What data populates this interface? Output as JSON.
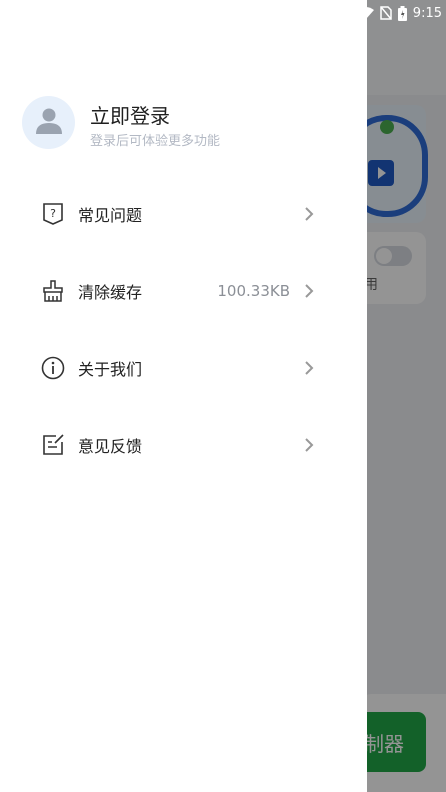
{
  "statusbar": {
    "time": "9:15"
  },
  "profile": {
    "title": "立即登录",
    "subtitle": "登录后可体验更多功能"
  },
  "menu": {
    "faq": {
      "label": "常见问题"
    },
    "clear_cache": {
      "label": "清除缓存",
      "value": "100.33KB"
    },
    "about": {
      "label": "关于我们"
    },
    "feedback": {
      "label": "意见反馈"
    }
  },
  "background": {
    "partial_text": "用",
    "button_text": "制器"
  },
  "colors": {
    "accent": "#22a748",
    "avatar_bg": "#e7f0fb",
    "subtitle": "#b3b9c4"
  }
}
